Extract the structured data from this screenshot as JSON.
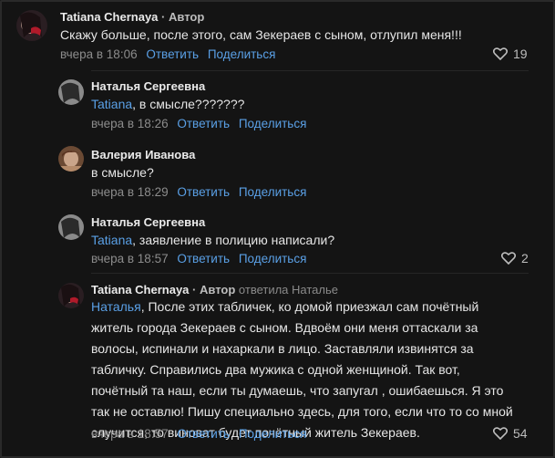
{
  "labels": {
    "author_badge": "Автор",
    "reply_label": "Ответить",
    "share_label": "Поделиться"
  },
  "comments": [
    {
      "author": "Tatiana Chernaya",
      "text": "Скажу больше, после этого, сам Зекераев с сыном, отлупил меня!!!",
      "time": "вчера в 18:06",
      "likes": "19"
    },
    {
      "author": "Наталья Сергеевна",
      "mention": "Tatiana",
      "text": ", в смысле???????",
      "time": "вчера в 18:26"
    },
    {
      "author": "Валерия Иванова",
      "text": "в смысле?",
      "time": "вчера в 18:29"
    },
    {
      "author": "Наталья Сергеевна",
      "mention": "Tatiana",
      "text": ", заявление в полицию написали?",
      "time": "вчера в 18:57",
      "likes": "2"
    },
    {
      "author": "Tatiana Chernaya",
      "reply_to": "ответила Наталье",
      "mention": "Наталья",
      "lines": [
        ", После этих табличек, ко домой приезжал сам почётный",
        "житель города Зекераев с сыном. Вдвоём они меня оттаскали за",
        "волосы, испинали и нахаркали в лицо. Заставляли извинятся за",
        "табличку. Справились два мужика с одной женщиной. Так вот,",
        "почётный та наш, если ты думаешь, что запугал , ошибаешься. Я это",
        "так не оставлю! Пишу специально здесь, для того, если что то со мной",
        "случится, то виноват будет почётный житель Зекераев."
      ],
      "time": "вчера в 18:57",
      "likes": "54"
    }
  ]
}
